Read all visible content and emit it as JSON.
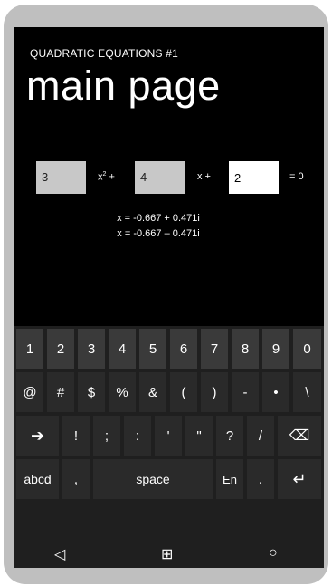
{
  "app": {
    "title": "QUADRATIC EQUATIONS #1",
    "page_title": "main page"
  },
  "equation": {
    "a": "3",
    "b": "4",
    "c": "2",
    "x2_term": "x",
    "x2_exp": "2",
    "plus1": "+",
    "x_term": "x +",
    "equals": "= 0"
  },
  "results": [
    "x = -0.667 + 0.471i",
    "x = -0.667 – 0.471i"
  ],
  "keyboard": {
    "row1": [
      "1",
      "2",
      "3",
      "4",
      "5",
      "6",
      "7",
      "8",
      "9",
      "0"
    ],
    "row2": [
      "@",
      "#",
      "$",
      "%",
      "&",
      "(",
      ")",
      "-",
      "•",
      "\\"
    ],
    "row3": [
      "➔",
      "!",
      ";",
      ":",
      "'",
      "\"",
      "?",
      "/",
      "⌫"
    ],
    "row4": [
      "abcd",
      ",",
      "space",
      "En",
      ".",
      "↵"
    ]
  },
  "navbar": {
    "back": "◁",
    "windows": "⊞",
    "search": "○"
  }
}
